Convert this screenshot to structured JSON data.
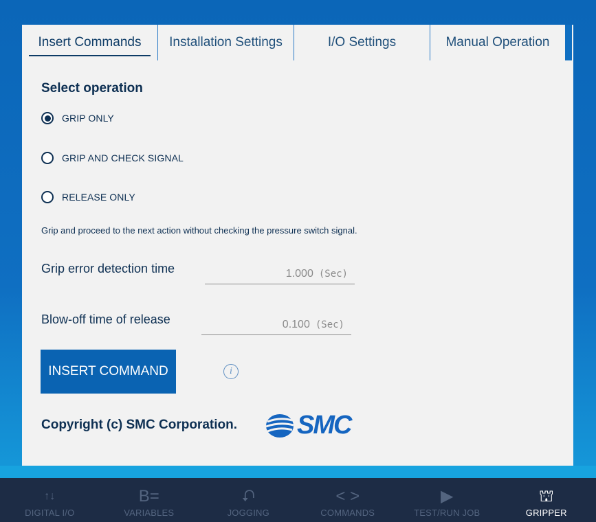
{
  "tabs": [
    {
      "label": "Insert Commands",
      "active": true
    },
    {
      "label": "Installation Settings",
      "active": false
    },
    {
      "label": "I/O Settings",
      "active": false
    },
    {
      "label": "Manual Operation",
      "active": false
    }
  ],
  "section_title": "Select operation",
  "options": [
    {
      "label": "GRIP ONLY",
      "selected": true
    },
    {
      "label": "GRIP AND CHECK SIGNAL",
      "selected": false
    },
    {
      "label": "RELEASE ONLY",
      "selected": false
    }
  ],
  "description": "Grip and proceed to the next action without checking the pressure switch signal.",
  "fields": {
    "grip_error": {
      "label": "Grip error detection time",
      "value": "1.000",
      "unit": "(Sec)"
    },
    "blow_off": {
      "label": "Blow-off time of release",
      "value": "0.100",
      "unit": "(Sec)"
    }
  },
  "insert_button": "INSERT COMMAND",
  "info_icon": "i",
  "copyright": "Copyright (c) SMC Corporation.",
  "logo_text": "SMC",
  "nav": [
    {
      "label": "DIGITAL I/O",
      "icon": "↑↓"
    },
    {
      "label": "VARIABLES",
      "icon": "B="
    },
    {
      "label": "JOGGING",
      "icon": "⮏"
    },
    {
      "label": "COMMANDS",
      "icon": "< >"
    },
    {
      "label": "TEST/RUN JOB",
      "icon": "▶"
    },
    {
      "label": "GRIPPER",
      "icon": "⛫"
    }
  ],
  "colors": {
    "accent": "#0a63b2",
    "text": "#0d2f52",
    "nav_bg": "#1d2c45"
  }
}
